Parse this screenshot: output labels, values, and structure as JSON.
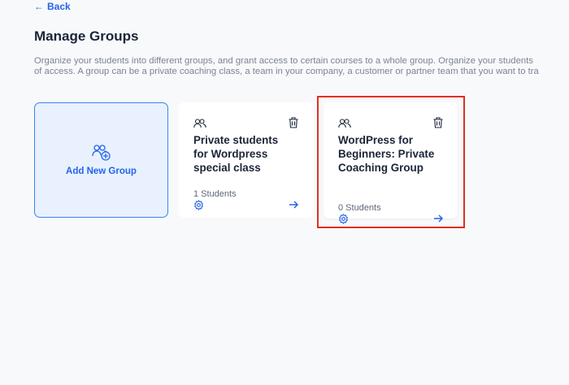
{
  "back_label": "Back",
  "page_title": "Manage Groups",
  "description_line1": "Organize your students into different groups, and grant access to certain courses to a whole group. Organize your students",
  "description_line2": "of access. A group can be a private coaching class, a team in your company, a customer or partner team that you want to tra",
  "add_group_label": "Add New Group",
  "groups": [
    {
      "name": "Private students for Wordpress special class",
      "students": "1 Students"
    },
    {
      "name": "WordPress for Beginners: Private Coaching Group",
      "students": "0 Students"
    }
  ],
  "colors": {
    "accent": "#2563eb",
    "highlight": "#e0301e"
  },
  "icons": {
    "back": "arrow-left-icon",
    "add_group": "add-group-icon",
    "group": "people-icon",
    "delete": "trash-icon",
    "settings": "gear-icon",
    "open": "arrow-right-icon"
  }
}
